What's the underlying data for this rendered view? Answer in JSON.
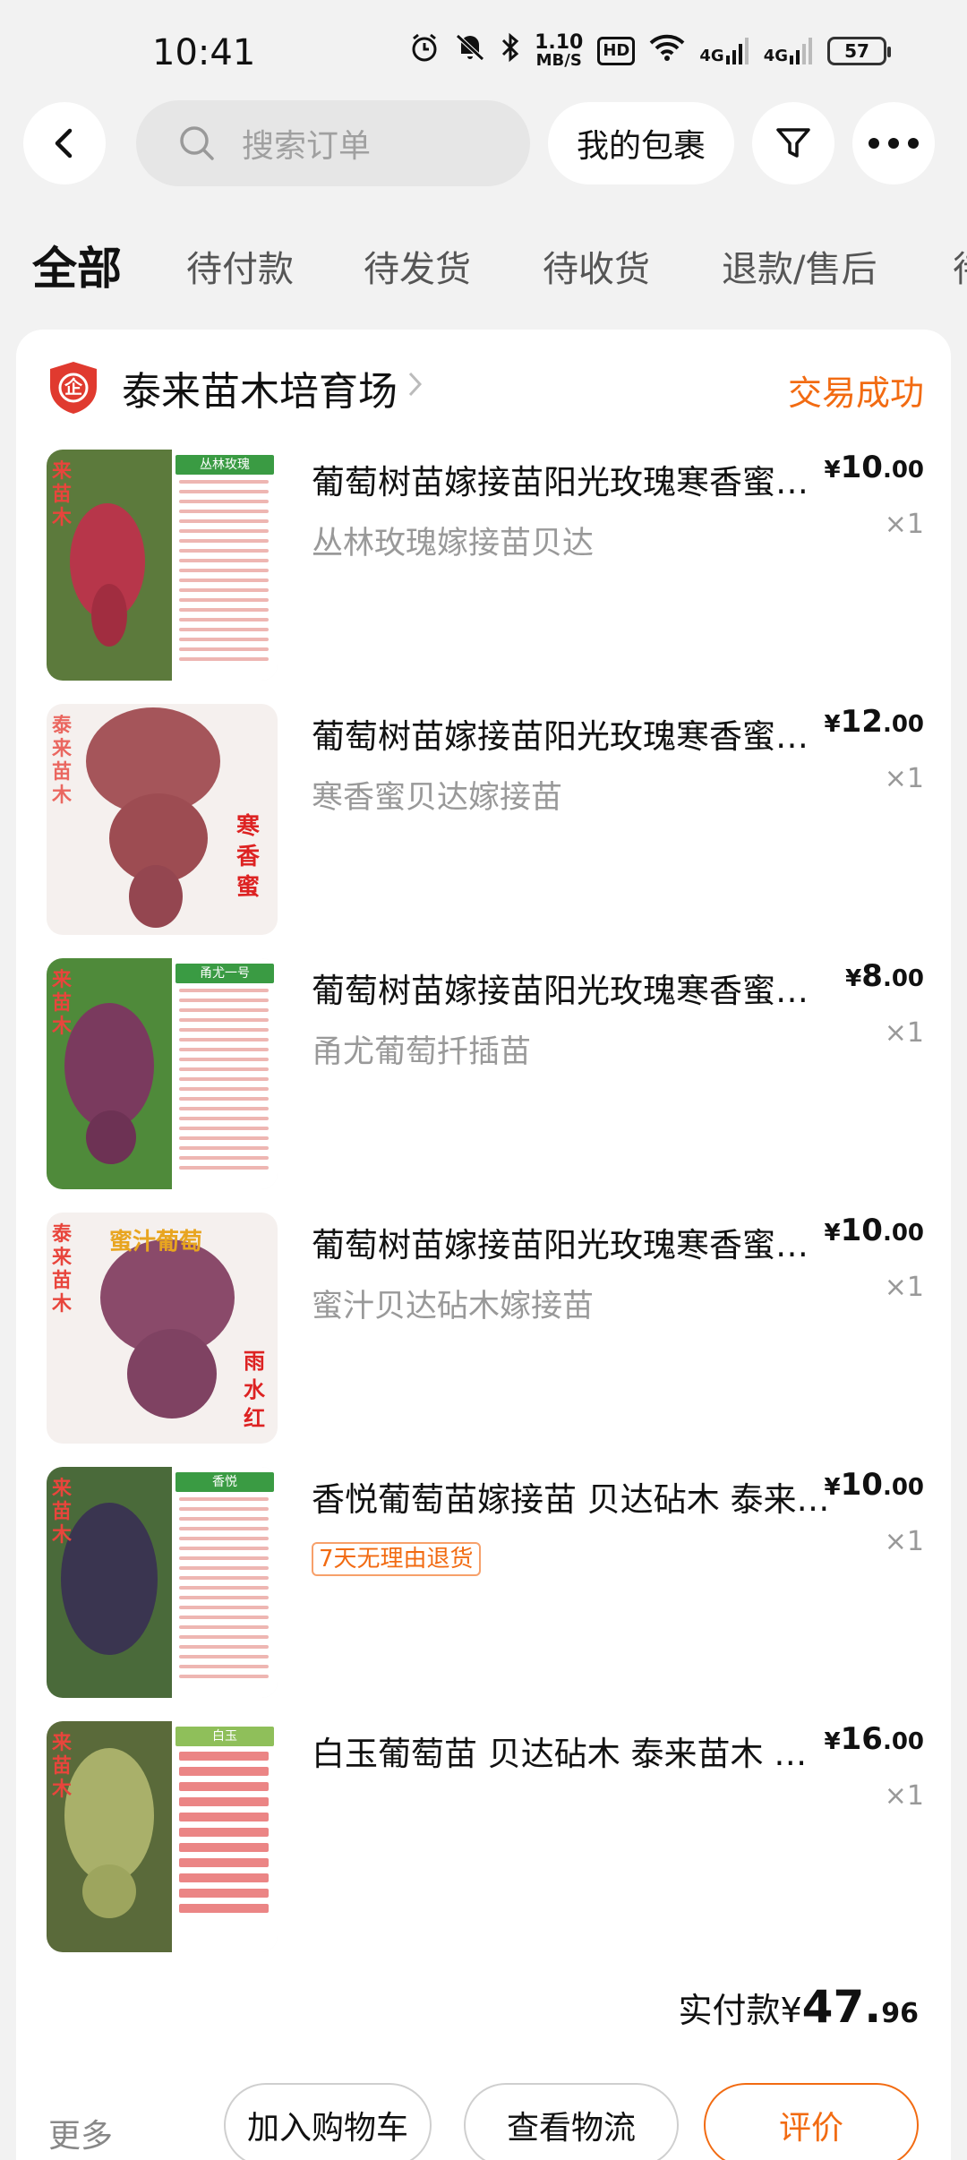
{
  "status_bar": {
    "time": "10:41",
    "speed_value": "1.10",
    "speed_unit": "MB/S",
    "hd": "HD",
    "net1": "4G",
    "net2": "4G",
    "battery": "57"
  },
  "top_bar": {
    "search_placeholder": "搜索订单",
    "package_label": "我的包裹",
    "icons": [
      "back-arrow",
      "search",
      "filter-funnel",
      "more-dots"
    ]
  },
  "tabs": [
    "全部",
    "待付款",
    "待发货",
    "待收货",
    "退款/售后",
    "待"
  ],
  "active_tab": 0,
  "order": {
    "shop_name": "泰来苗木培育场",
    "shop_badge": "企",
    "status": "交易成功",
    "items": [
      {
        "title": "葡萄树苗嫁接苗阳光玫瑰寒香蜜贝达砧木",
        "sub": "丛林玫瑰嫁接苗贝达",
        "price_int": "10",
        "price_dec": ".00",
        "qty": "×1",
        "thumb_side_label": "来苗木",
        "thumb_panel_title": "丛林玫瑰",
        "thumb_colors": {
          "grape": "#b7364a",
          "bg": "#5c7a3c"
        }
      },
      {
        "title": "葡萄树苗嫁接苗阳光玫瑰寒香蜜贝达砧木",
        "sub": "寒香蜜贝达嫁接苗",
        "price_int": "12",
        "price_dec": ".00",
        "qty": "×1",
        "thumb_side_label": "泰来苗木",
        "thumb_corner_label": "寒香蜜",
        "thumb_colors": {
          "grape": "#a5555a",
          "bg": "#f6efee"
        }
      },
      {
        "title": "葡萄树苗嫁接苗阳光玫瑰寒香蜜贝达砧木",
        "sub": "甬尤葡萄扦插苗",
        "price_int": "8",
        "price_dec": ".00",
        "qty": "×1",
        "thumb_side_label": "来苗木",
        "thumb_panel_title": "甬尤一号",
        "thumb_colors": {
          "grape": "#7a3a5e",
          "bg": "#4f8a3a"
        }
      },
      {
        "title": "葡萄树苗嫁接苗阳光玫瑰寒香蜜贝达砧木",
        "sub": "蜜汁贝达砧木嫁接苗",
        "price_int": "10",
        "price_dec": ".00",
        "qty": "×1",
        "thumb_side_label": "泰来苗木",
        "thumb_top_label": "蜜汁葡萄",
        "thumb_corner_label": "雨水红",
        "thumb_colors": {
          "grape": "#8a4a6a",
          "bg": "#f6efee"
        }
      },
      {
        "title": "香悦葡萄苗嫁接苗 贝达砧木 泰来苗木",
        "tag": "7天无理由退货",
        "price_int": "10",
        "price_dec": ".00",
        "qty": "×1",
        "thumb_side_label": "来苗木",
        "thumb_panel_title": "香悦",
        "thumb_colors": {
          "grape": "#3a3550",
          "bg": "#4a6a3a"
        }
      },
      {
        "title": "白玉葡萄苗 贝达砧木 泰来苗木 嫁接苗",
        "price_int": "16",
        "price_dec": ".00",
        "qty": "×1",
        "thumb_side_label": "来苗木",
        "thumb_panel_title": "白玉",
        "thumb_colors": {
          "grape": "#a9b06a",
          "bg": "#5a6a3a"
        }
      }
    ],
    "total_label": "实付款",
    "total_yen": "¥",
    "total_int": "47.",
    "total_dec": "96"
  },
  "actions": {
    "more": "更多",
    "add_cart": "加入购物车",
    "logistics": "查看物流",
    "review": "评价"
  },
  "colors": {
    "accent": "#f26b12",
    "background": "#f2f2f2"
  }
}
